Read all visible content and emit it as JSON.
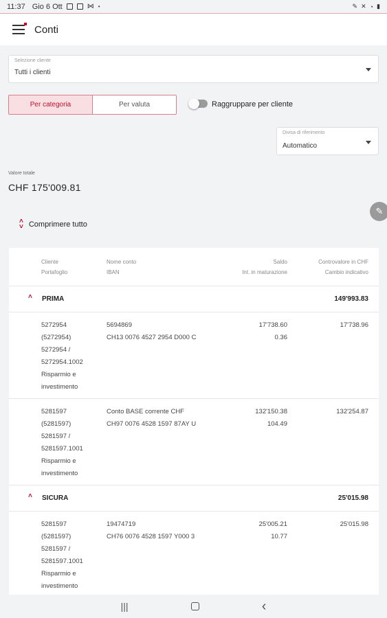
{
  "status": {
    "time": "11:37",
    "date": "Gio 6 Ott",
    "icons": [
      "image-icon",
      "box-icon",
      "mail-icon",
      "dot-icon"
    ],
    "right_icons": [
      "edit-icon",
      "mute-icon",
      "wifi-icon",
      "battery-icon"
    ]
  },
  "header": {
    "title": "Conti"
  },
  "client_select": {
    "label": "Selezione cliente",
    "value": "Tutti i clienti"
  },
  "segment": {
    "active": "Per categoria",
    "inactive": "Per valuta"
  },
  "group_toggle": {
    "label": "Raggruppare per cliente"
  },
  "currency_select": {
    "label": "Divisa di riferimento",
    "value": "Automatico"
  },
  "total": {
    "label": "Valore totale",
    "value": "CHF 175'009.81"
  },
  "collapse_all": {
    "label": "Comprimere tutto"
  },
  "table": {
    "headers": {
      "client": "Cliente",
      "portfolio": "Portafoglio",
      "account_name": "Nome conto",
      "iban": "IBAN",
      "balance": "Saldo",
      "interest": "Int. in maturazione",
      "countervalue": "Controvalore in CHF",
      "rate": "Cambio indicativo"
    },
    "groups": [
      {
        "name": "PRIMA",
        "total": "149'993.83",
        "rows": [
          {
            "client_lines": [
              "5272954",
              "(5272954)",
              "5272954 /",
              "5272954.1002",
              "Risparmio e",
              "investimento"
            ],
            "account_name": "5694869",
            "iban": "CH13 0076 4527 2954 D000 C",
            "balance": "17'738.60",
            "interest": "0.36",
            "countervalue": "17'738.96"
          },
          {
            "client_lines": [
              "5281597",
              "(5281597)",
              "5281597 /",
              "5281597.1001",
              "Risparmio e",
              "investimento"
            ],
            "account_name": "Conto BASE corrente CHF",
            "iban": "CH97 0076 4528 1597 87AY U",
            "balance": "132'150.38",
            "interest": "104.49",
            "countervalue": "132'254.87"
          }
        ]
      },
      {
        "name": "SICURA",
        "total": "25'015.98",
        "rows": [
          {
            "client_lines": [
              "5281597",
              "(5281597)",
              "5281597 /",
              "5281597.1001",
              "Risparmio e",
              "investimento"
            ],
            "account_name": "19474719",
            "iban": "CH76 0076 4528 1597 Y000 3",
            "balance": "25'005.21",
            "interest": "10.77",
            "countervalue": "25'015.98"
          }
        ]
      }
    ]
  },
  "nav": {
    "recents": "|||",
    "back": "‹"
  },
  "colors": {
    "accent": "#c0102c",
    "accent_bg": "#f9dfe2",
    "page_bg": "#f2f3f5"
  }
}
